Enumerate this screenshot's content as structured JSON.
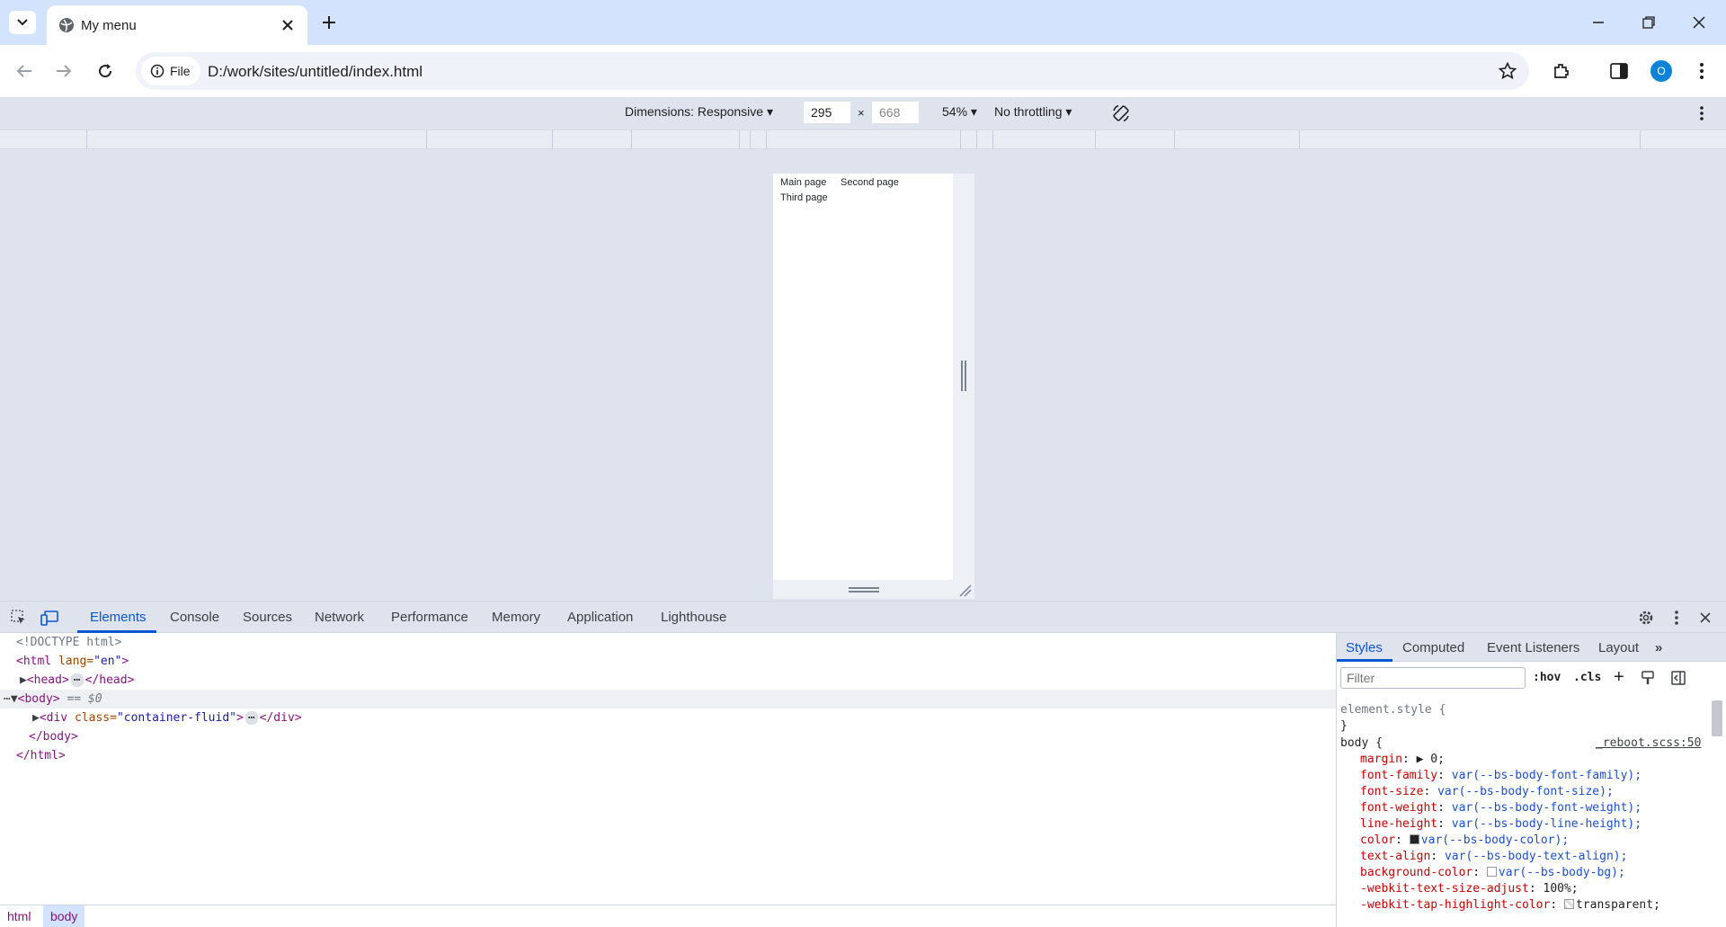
{
  "browser": {
    "tab": {
      "title": "My menu"
    },
    "omnibox": {
      "chip_label": "File",
      "url": "D:/work/sites/untitled/index.html"
    },
    "avatar_letter": "O"
  },
  "device_toolbar": {
    "dimensions_label": "Dimensions: Responsive",
    "width": "295",
    "height": "668",
    "times": "×",
    "zoom": "54%",
    "throttling": "No throttling"
  },
  "page": {
    "links": [
      "Main page",
      "Second page",
      "Third page"
    ]
  },
  "devtools": {
    "tabs": [
      "Elements",
      "Console",
      "Sources",
      "Network",
      "Performance",
      "Memory",
      "Application",
      "Lighthouse"
    ],
    "dom_lines": [
      {
        "text": "<!DOCTYPE html>"
      },
      {
        "open": "<html",
        "attr": " lang=",
        "val": "\"en\"",
        "close": ">"
      },
      {
        "open": "<head>",
        "close": "</head>"
      },
      {
        "open": "<body>",
        "suffix": " == $0"
      },
      {
        "open": "<div",
        "attr": " class=",
        "val": "\"container-fluid\"",
        "mid": ">",
        "close": "</div>"
      },
      {
        "text": "</body>"
      },
      {
        "text": "</html>"
      }
    ],
    "breadcrumb": [
      "html",
      "body"
    ],
    "styles": {
      "tabs": [
        "Styles",
        "Computed",
        "Event Listeners",
        "Layout"
      ],
      "filter_placeholder": "Filter",
      "hov": ":hov",
      "cls": ".cls",
      "element_style": "element.style {",
      "brace_close": "}",
      "rule_selector": "body {",
      "rule_source": "_reboot.scss:50",
      "declarations": [
        {
          "prop": "margin",
          "val": "▶ 0;"
        },
        {
          "prop": "font-family",
          "val": "var(--bs-body-font-family);"
        },
        {
          "prop": "font-size",
          "val": "var(--bs-body-font-size);"
        },
        {
          "prop": "font-weight",
          "val": "var(--bs-body-font-weight);"
        },
        {
          "prop": "line-height",
          "val": "var(--bs-body-line-height);"
        },
        {
          "prop": "color",
          "val": "var(--bs-body-color);"
        },
        {
          "prop": "text-align",
          "val": "var(--bs-body-text-align);"
        },
        {
          "prop": "background-color",
          "val": "var(--bs-body-bg);"
        },
        {
          "prop": "-webkit-text-size-adjust",
          "val": "100%;"
        },
        {
          "prop": "-webkit-tap-highlight-color",
          "val": "transparent;"
        }
      ]
    }
  }
}
